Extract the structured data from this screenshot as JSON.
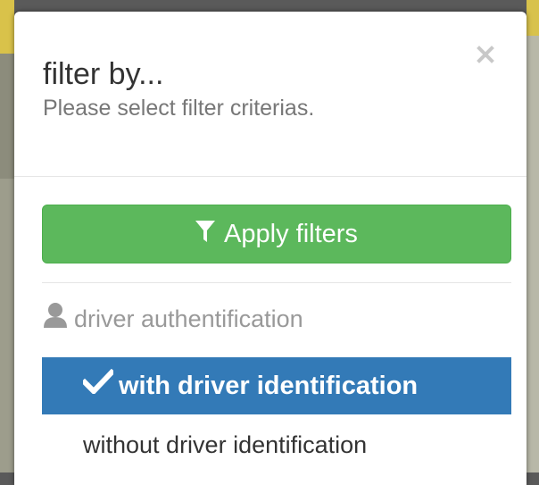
{
  "modal": {
    "title": "filter by...",
    "subtitle": "Please select filter criterias.",
    "close_label": "×"
  },
  "actions": {
    "apply_label": "Apply filters"
  },
  "filter_group": {
    "label": "driver authentification",
    "options": [
      {
        "label": "with driver identification",
        "selected": true
      },
      {
        "label": "without driver identification",
        "selected": false
      }
    ]
  },
  "colors": {
    "apply_button": "#5cb85c",
    "selected_option": "#337ab7",
    "title_text": "#333333",
    "muted_text": "#777777"
  },
  "icons": {
    "close": "close-icon",
    "filter": "filter-icon",
    "user": "user-icon",
    "checkmark": "checkmark-icon"
  }
}
